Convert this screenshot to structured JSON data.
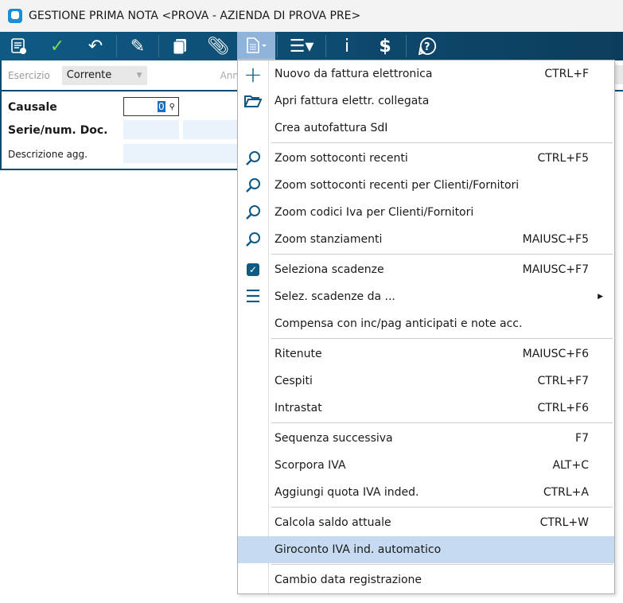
{
  "window": {
    "title": "GESTIONE PRIMA NOTA <PROVA - AZIENDA DI PROVA PRE>"
  },
  "toolbar": {
    "info": "i",
    "dollar": "$"
  },
  "form": {
    "esercizio_label": "Esercizio",
    "esercizio_value": "Corrente",
    "anno_label": "Ann",
    "causale_label": "Causale",
    "causale_value": "0",
    "serie_label": "Serie/num. Doc.",
    "descrizione_label": "Descrizione agg."
  },
  "menu": {
    "items": [
      {
        "label": "Nuovo da fattura elettronica",
        "shortcut": "CTRL+F",
        "icon": "plus-icon"
      },
      {
        "label": "Apri fattura elettr. collegata",
        "shortcut": "",
        "icon": "folder-icon"
      },
      {
        "label": "Crea autofattura SdI",
        "shortcut": ""
      },
      {
        "label": "Zoom sottoconti recenti",
        "shortcut": "CTRL+F5",
        "icon": "search-icon"
      },
      {
        "label": "Zoom sottoconti recenti per Clienti/Fornitori",
        "shortcut": "",
        "icon": "search-icon"
      },
      {
        "label": "Zoom codici Iva per Clienti/Fornitori",
        "shortcut": "",
        "icon": "search-icon"
      },
      {
        "label": "Zoom stanziamenti",
        "shortcut": "MAIUSC+F5",
        "icon": "search-icon"
      },
      {
        "label": "Seleziona scadenze",
        "shortcut": "MAIUSC+F7",
        "icon": "checkbox-icon"
      },
      {
        "label": "Selez. scadenze da ...",
        "shortcut": "",
        "icon": "list-icon"
      },
      {
        "label": "Compensa con inc/pag anticipati e note acc.",
        "shortcut": ""
      },
      {
        "label": "Ritenute",
        "shortcut": "MAIUSC+F6"
      },
      {
        "label": "Cespiti",
        "shortcut": "CTRL+F7"
      },
      {
        "label": "Intrastat",
        "shortcut": "CTRL+F6"
      },
      {
        "label": "Sequenza successiva",
        "shortcut": "F7"
      },
      {
        "label": "Scorpora IVA",
        "shortcut": "ALT+C"
      },
      {
        "label": "Aggiungi quota IVA inded.",
        "shortcut": "CTRL+A"
      },
      {
        "label": "Calcola saldo attuale",
        "shortcut": "CTRL+W"
      },
      {
        "label": "Giroconto IVA ind. automatico",
        "shortcut": ""
      },
      {
        "label": "Cambio data registrazione",
        "shortcut": ""
      }
    ]
  }
}
